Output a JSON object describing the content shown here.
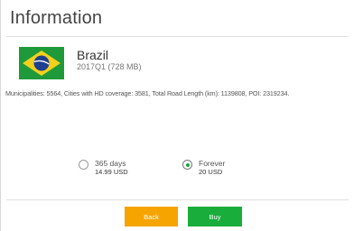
{
  "dialog": {
    "title": "Information"
  },
  "product": {
    "country": "Brazil",
    "flag_icon": "brazil-flag-icon",
    "version": "2017Q1 (728 MB)",
    "stats": "Municipalities: 5564, Cities with HD coverage: 3581, Total Road Length (km): 1139808, POI: 2319234."
  },
  "options": [
    {
      "label": "365 days",
      "price": "14.99 USD",
      "selected": false
    },
    {
      "label": "Forever",
      "price": "20 USD",
      "selected": true
    }
  ],
  "buttons": {
    "back_label": "Back",
    "buy_label": "Buy"
  },
  "colors": {
    "back": "#f5a400",
    "buy": "#19ad3c",
    "radio_selected": "#16a83c"
  }
}
